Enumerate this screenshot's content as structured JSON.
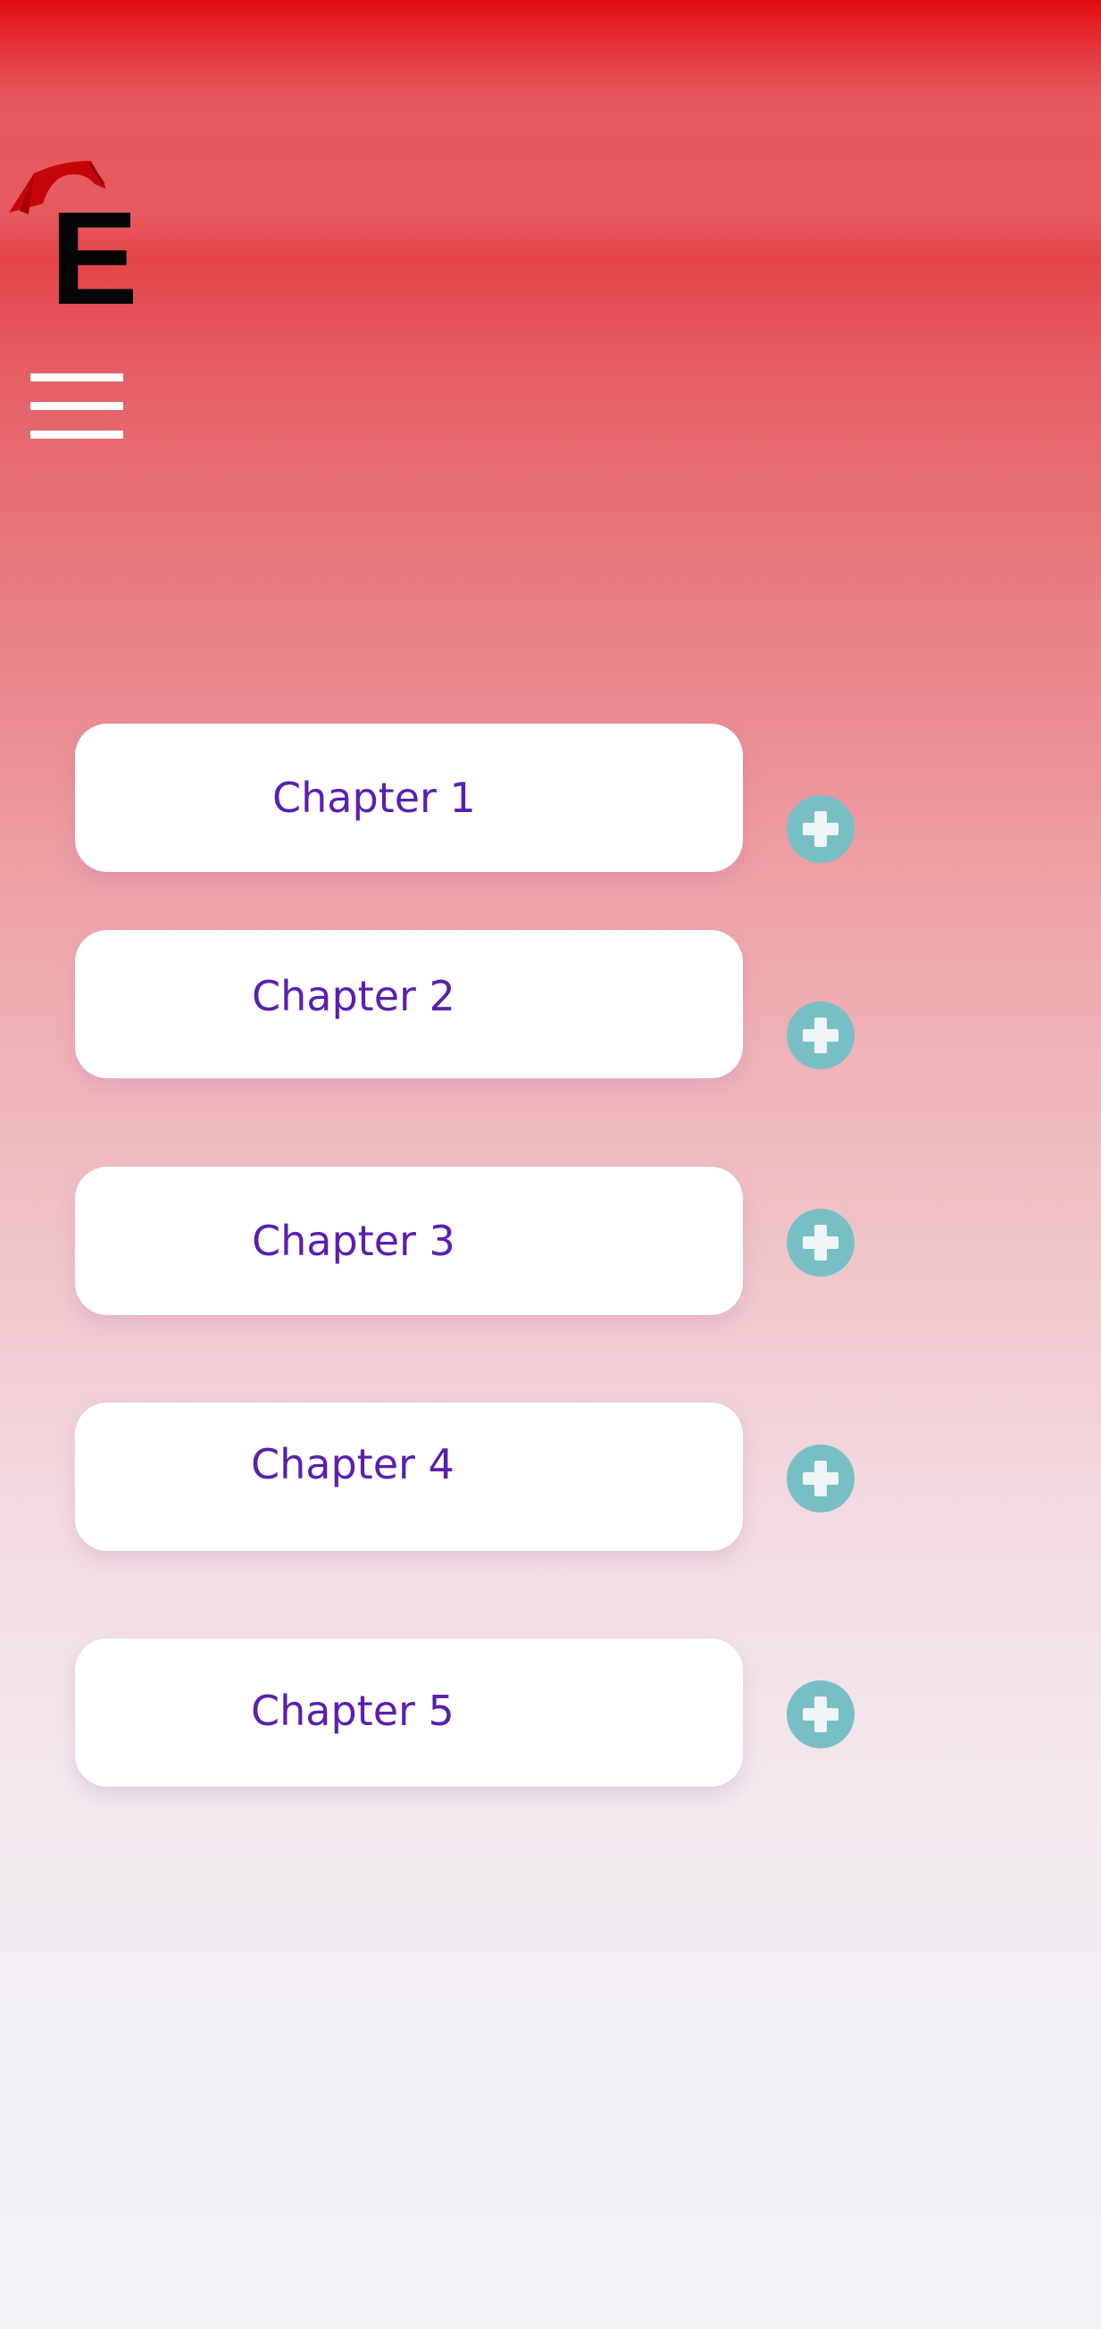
{
  "header": {
    "logo_letter": "E",
    "logo_icon": "graduation-cap-icon",
    "menu_icon": "hamburger-menu-icon"
  },
  "chapters": [
    {
      "label": "Chapter 1",
      "action_icon": "plus-circle-icon"
    },
    {
      "label": "Chapter 2",
      "action_icon": "plus-circle-icon"
    },
    {
      "label": "Chapter 3",
      "action_icon": "plus-circle-icon"
    },
    {
      "label": "Chapter 4",
      "action_icon": "plus-circle-icon"
    },
    {
      "label": "Chapter 5",
      "action_icon": "plus-circle-icon"
    }
  ],
  "colors": {
    "header_red": "#e20c10",
    "chapter_text": "#5a1fb0",
    "add_button": "#78bfc5",
    "card_bg": "#ffffff"
  }
}
